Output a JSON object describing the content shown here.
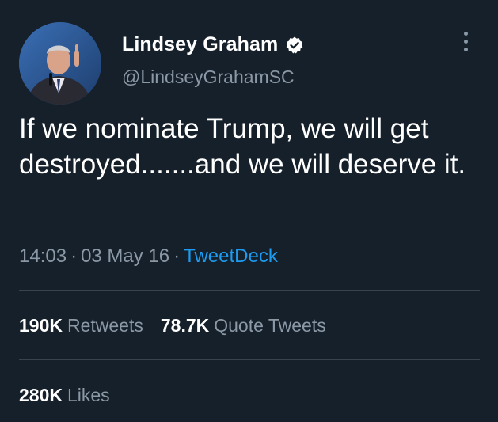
{
  "author": {
    "name": "Lindsey Graham",
    "handle": "@LindseyGrahamSC",
    "verified_badge_color": "#ffffff"
  },
  "tweet": {
    "text": "If we nominate Trump, we will get destroyed.......and we will deserve it.",
    "time": "14:03",
    "separator": "·",
    "date": "03 May 16",
    "source": "TweetDeck"
  },
  "stats": {
    "retweets_count": "190K",
    "retweets_label": "Retweets",
    "quotes_count": "78.7K",
    "quotes_label": "Quote Tweets",
    "likes_count": "280K",
    "likes_label": "Likes"
  },
  "colors": {
    "background": "#15202b",
    "secondary_text": "#8b98a5",
    "link": "#1d9bf0",
    "divider": "#38444d"
  },
  "icons": [
    "verified-badge-icon",
    "more-options-icon"
  ]
}
